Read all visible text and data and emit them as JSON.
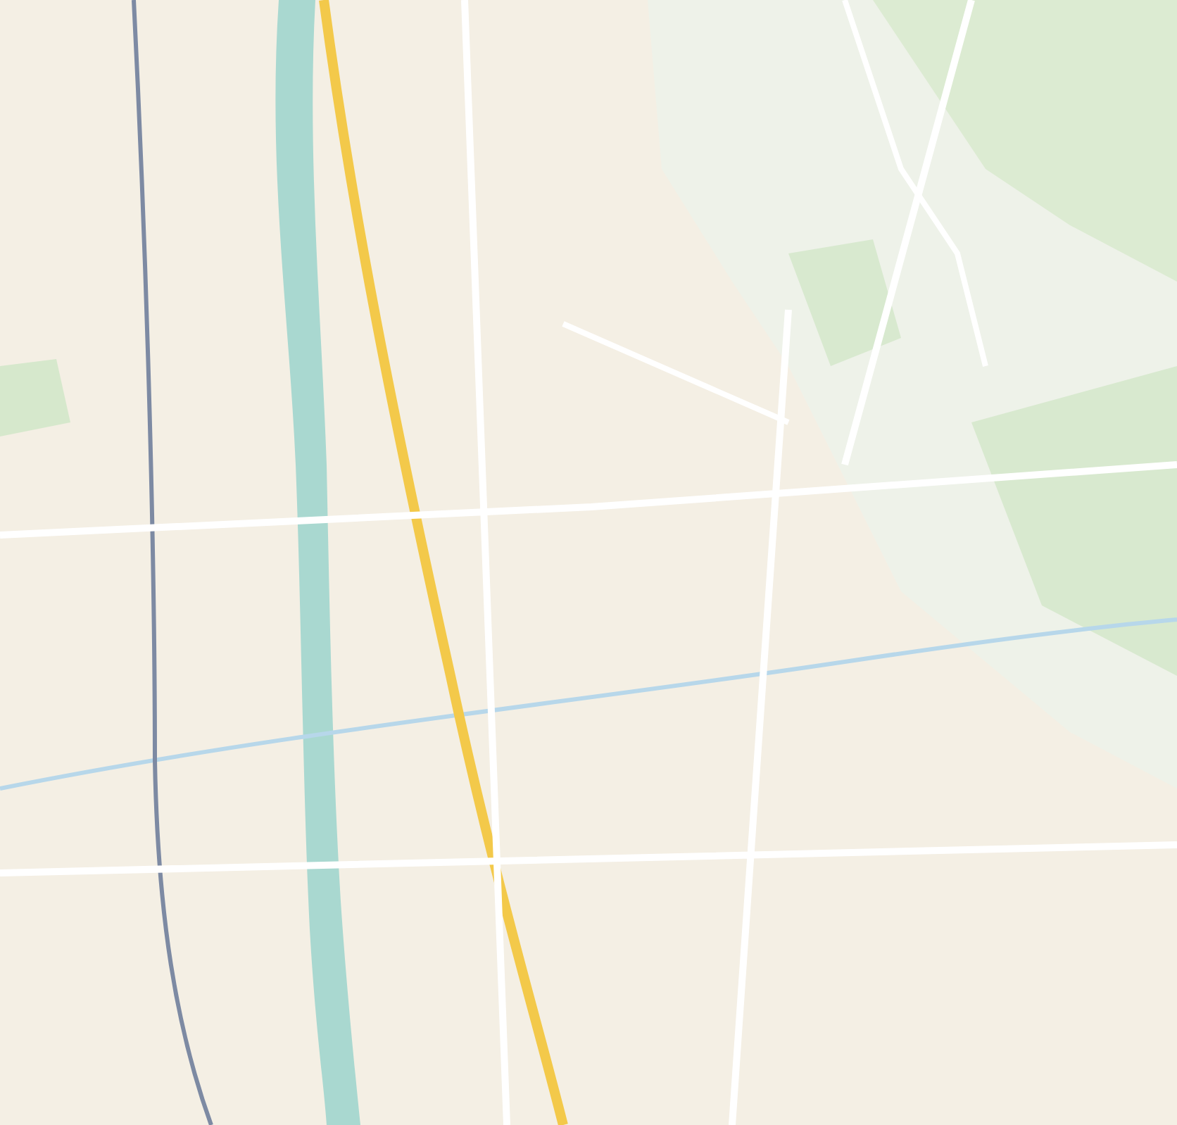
{
  "map": {
    "kind": "street"
  }
}
